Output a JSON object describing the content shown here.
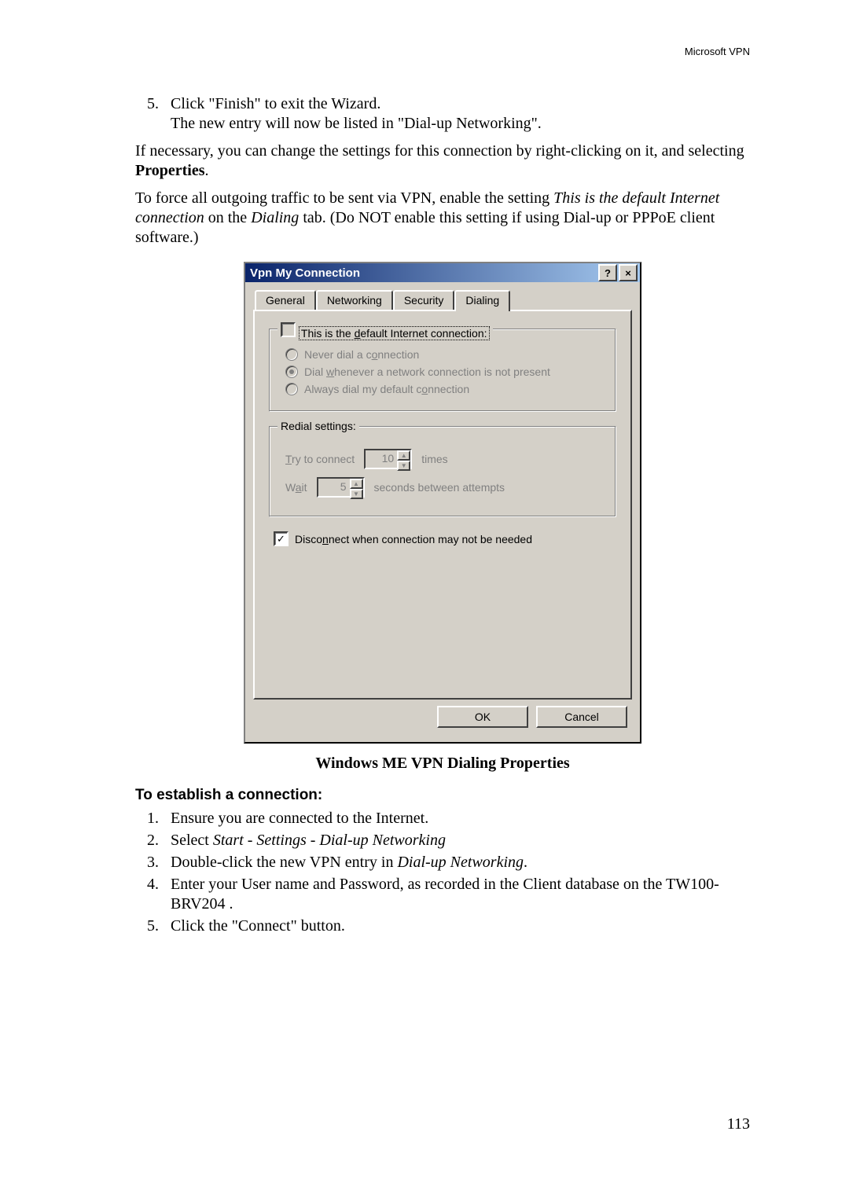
{
  "header": {
    "product": "Microsoft VPN"
  },
  "intro": {
    "item5_a": "Click \"Finish\" to exit the Wizard.",
    "item5_b": "The new entry will now be listed in \"Dial-up Networking\".",
    "p1_a": "If necessary, you can change the settings for this connection by right-clicking on it, and select",
    "p1_b": "ing ",
    "p1_bold": "Properties",
    "p1_c": ".",
    "p2_a": "To force all outgoing traffic to be sent via VPN, enable the setting ",
    "p2_i1": "This is the default Internet connection",
    "p2_b": " on the ",
    "p2_i2": "Dialing",
    "p2_c": " tab. (Do NOT enable this setting if using Dial-up or PPPoE client software.)"
  },
  "dialog": {
    "title": "Vpn My Connection",
    "help": "?",
    "close": "×",
    "tabs": {
      "general": "General",
      "networking": "Networking",
      "security": "Security",
      "dialing": "Dialing"
    },
    "group1": {
      "legend_a": "This is the ",
      "legend_u": "d",
      "legend_b": "efault Internet connection:",
      "opt1_a": "Never dial a c",
      "opt1_u": "o",
      "opt1_b": "nnection",
      "opt2_a": "Dial ",
      "opt2_u": "w",
      "opt2_b": "henever a network connection is not present",
      "opt3_a": "Always dial my default c",
      "opt3_u": "o",
      "opt3_b": "nnection"
    },
    "group2": {
      "legend": "Redial settings:",
      "try_u": "T",
      "try_b": "ry to connect",
      "try_val": "10",
      "try_unit": "times",
      "wait_a": "W",
      "wait_u": "a",
      "wait_b": "it",
      "wait_val": "5",
      "wait_unit": "seconds between attempts"
    },
    "disconnect_a": "Disco",
    "disconnect_u": "n",
    "disconnect_b": "nect when connection may not be needed",
    "ok": "OK",
    "cancel": "Cancel"
  },
  "caption": "Windows ME VPN Dialing Properties",
  "section": {
    "title": "To establish a connection:",
    "s1": "Ensure you are connected to the Internet.",
    "s2_a": "Select ",
    "s2_i": "Start - Settings - Dial-up Networking",
    "s3_a": "Double-click the new VPN entry in ",
    "s3_i": "Dial-up Networking",
    "s3_b": ".",
    "s4": "Enter your User name and Password, as recorded in the Client database on the TW100-BRV204 .",
    "s5": "Click the \"Connect\" button."
  },
  "page_number": "113"
}
